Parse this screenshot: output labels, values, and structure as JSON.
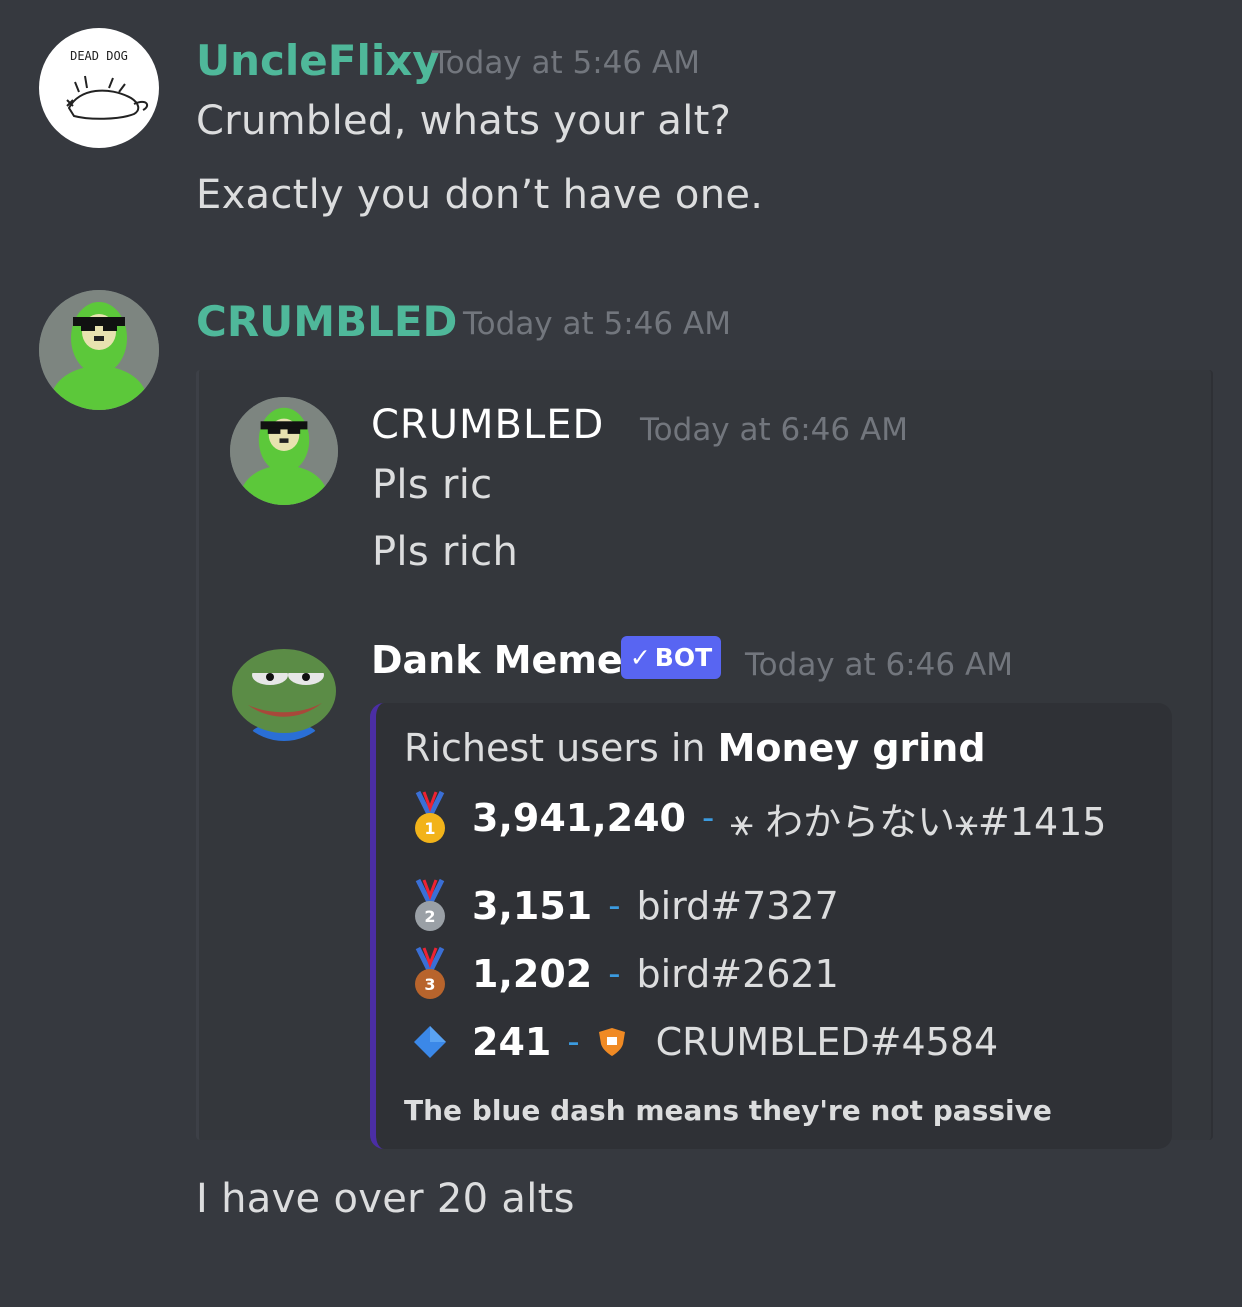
{
  "messages": [
    {
      "username": "UncleFlixy",
      "username_color": "#4fb89a",
      "timestamp": "Today at 5:46 AM",
      "avatar": {
        "text": "DEAD DOG",
        "icon": "dead-dog-cat-drawing"
      },
      "lines": [
        "Crumbled, whats your alt?",
        "Exactly you don’t have one."
      ]
    },
    {
      "username": "CRUMBLED",
      "username_color": "#4fb89a",
      "timestamp": "Today at 5:46 AM",
      "avatar": {
        "icon": "green-cartoon-with-sunglasses"
      },
      "after_text": "I have over 20 alts"
    }
  ],
  "quoted": {
    "message1": {
      "username": "CRUMBLED",
      "timestamp": "Today at 6:46 AM",
      "lines": [
        "Pls ric",
        "Pls rich"
      ]
    },
    "message2": {
      "username": "Dank Memer",
      "badge": "BOT",
      "timestamp": "Today at 6:46 AM",
      "avatar": {
        "icon": "pepe-frog"
      },
      "embed": {
        "accent_color": "#4b2ea5",
        "title_prefix": "Richest users in ",
        "title_bold": "Money grind",
        "entries": [
          {
            "rank_icon": "gold-medal-icon",
            "rank": "1",
            "amount": "3,941,240",
            "dash": "-",
            "user": "⚹ わからない⚹#1415"
          },
          {
            "rank_icon": "silver-medal-icon",
            "rank": "2",
            "amount": "3,151",
            "dash": "-",
            "user": "bird#7327"
          },
          {
            "rank_icon": "bronze-medal-icon",
            "rank": "3",
            "amount": "1,202",
            "dash": "-",
            "user": "bird#2621"
          },
          {
            "rank_icon": "blue-diamond-icon",
            "rank": "",
            "amount": "241",
            "dash": "-",
            "user": "CRUMBLED#4584",
            "user_badge": "orange-shield-icon"
          }
        ],
        "footer": "The blue dash means they're not passive"
      }
    }
  }
}
